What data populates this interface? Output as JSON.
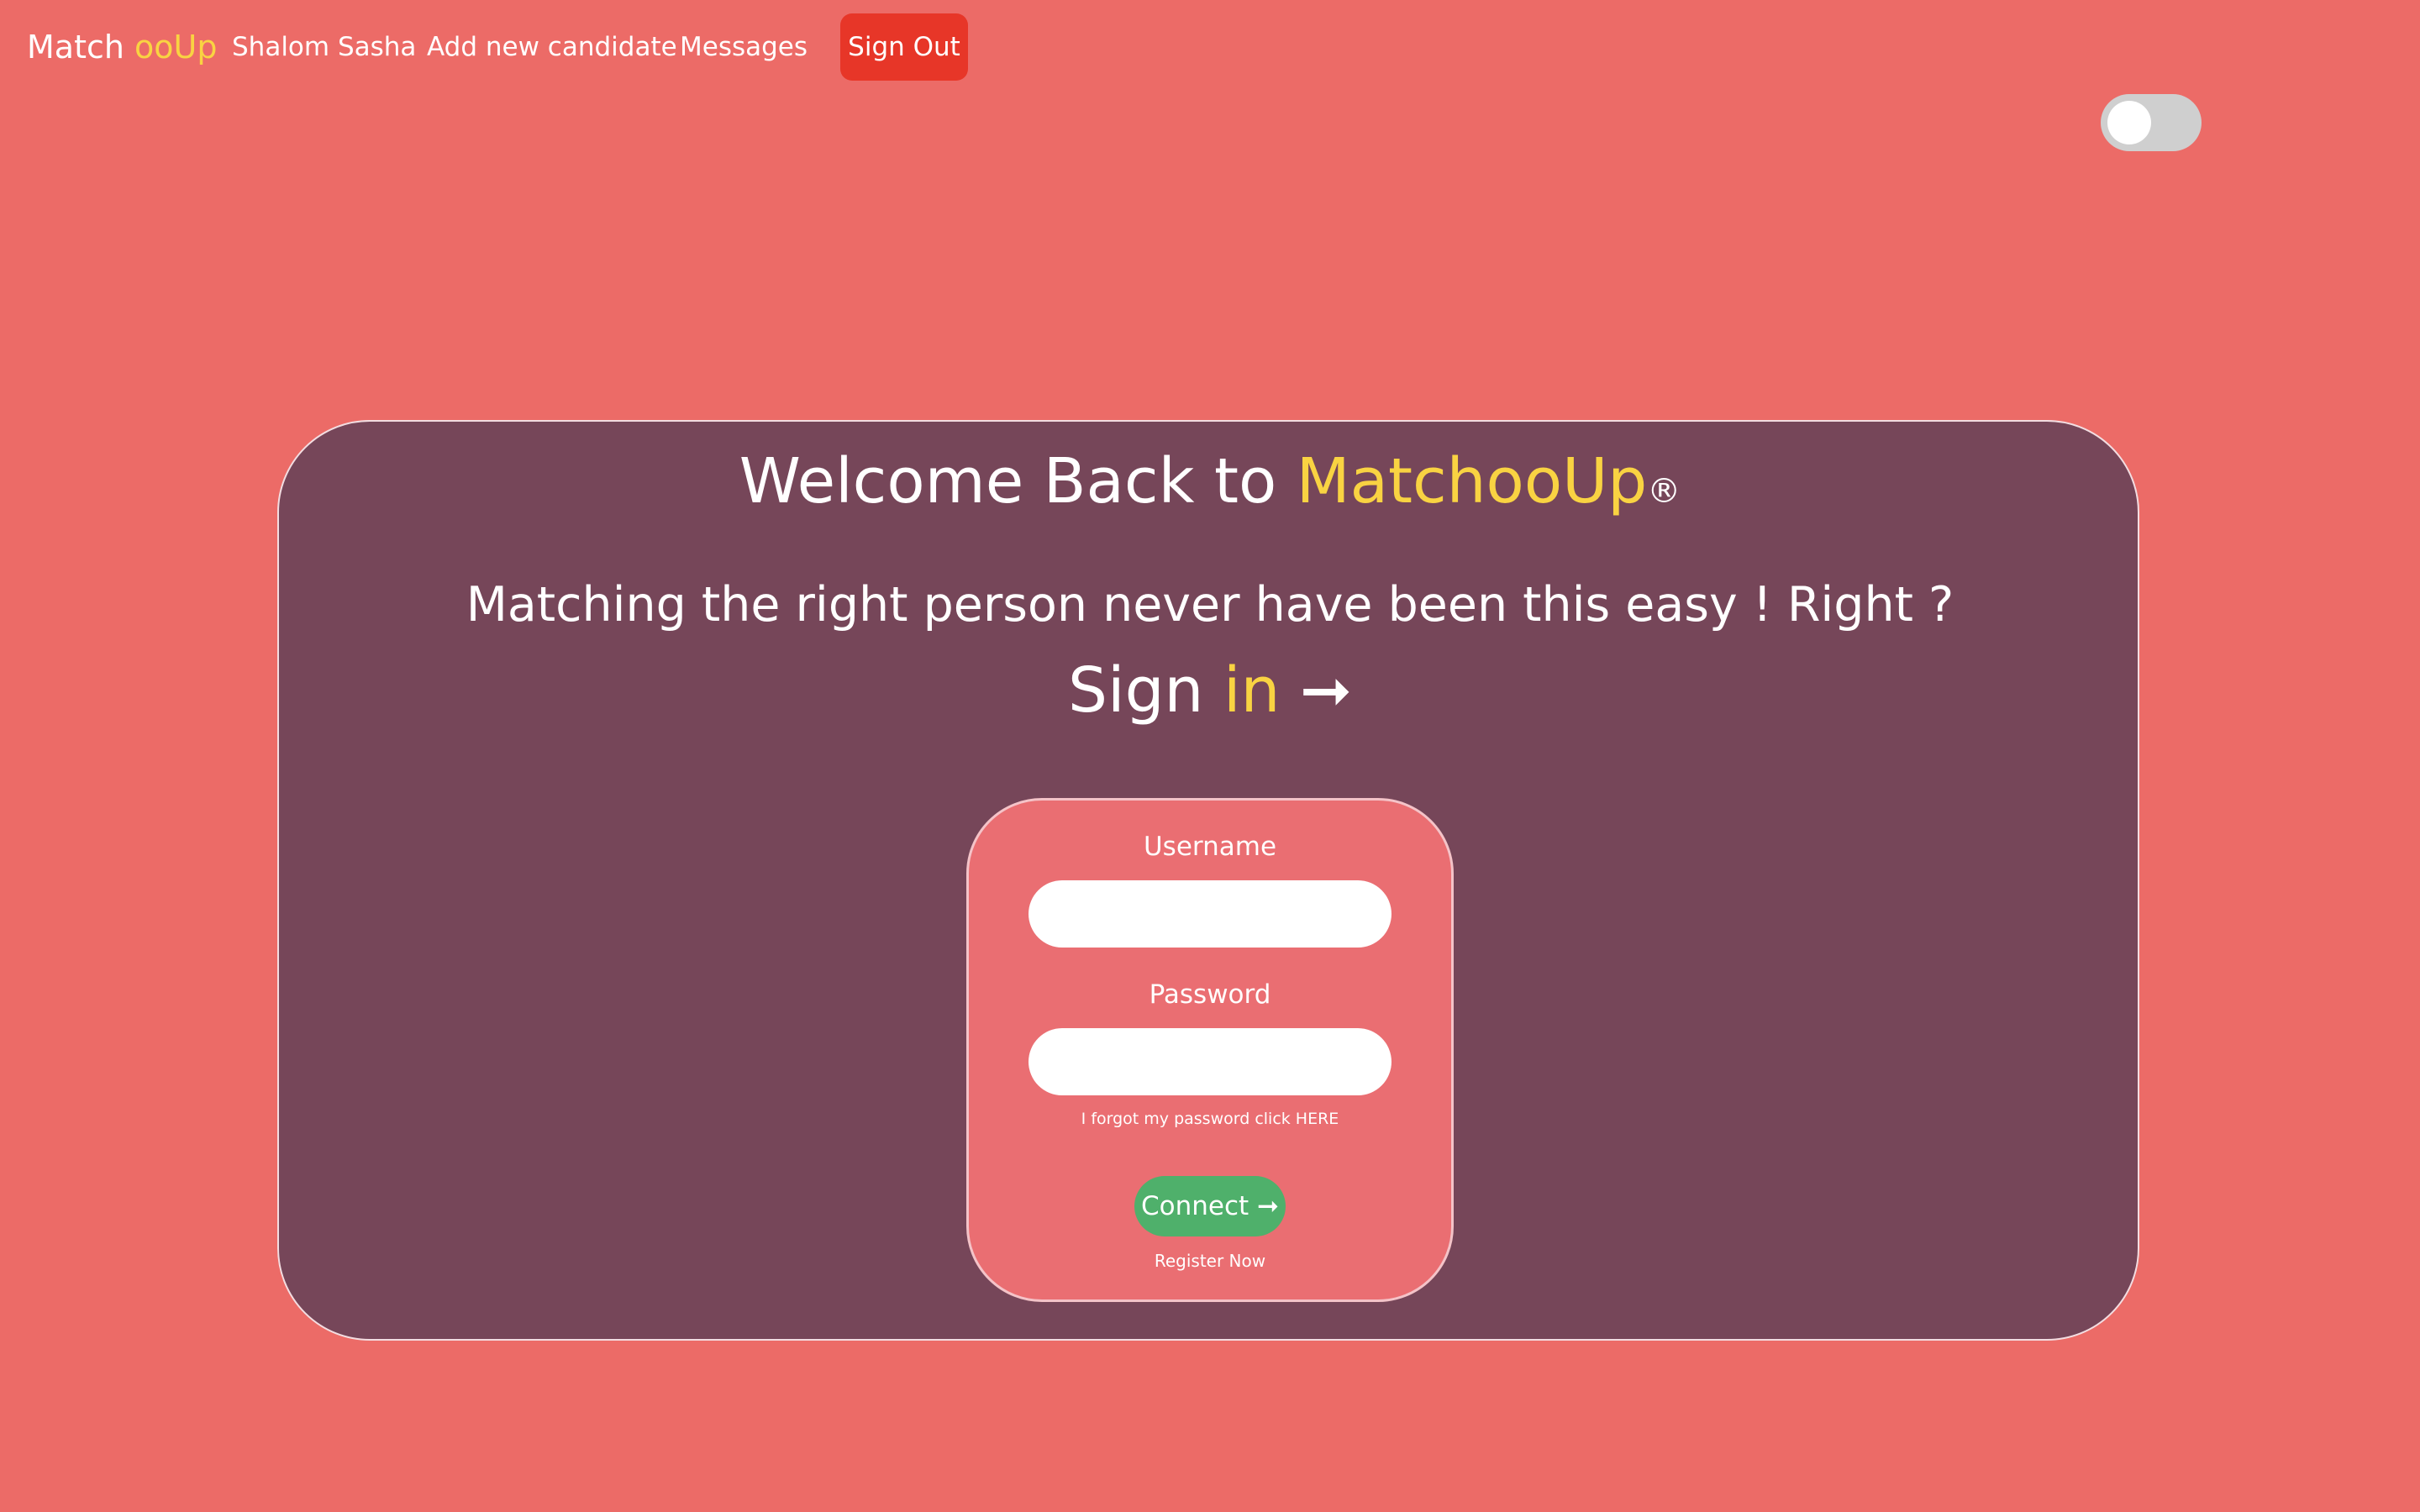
{
  "colors": {
    "background": "#ec6b67",
    "card": "#764659",
    "form_box": "#ea6e72",
    "accent": "#f9d342",
    "sign_out": "#e73628",
    "connect": "#4fb06b",
    "toggle_track": "#cfcfcf"
  },
  "nav": {
    "brand_prefix": "Match ",
    "brand_accent": "ooUp",
    "links": [
      {
        "label": "Shalom Sasha"
      },
      {
        "label": "Add new candidate"
      },
      {
        "label": "Messages"
      }
    ],
    "sign_out_label": "Sign Out"
  },
  "theme_toggle": {
    "state": "off"
  },
  "hero": {
    "welcome_prefix": "Welcome Back to ",
    "welcome_brand": "MatchooUp",
    "registered_mark": "®",
    "tagline": "Matching the right person never have been this easy ! Right ?",
    "sign_in_prefix": "Sign ",
    "sign_in_accent": "in",
    "sign_in_arrow": " ➞"
  },
  "login_form": {
    "username_label": "Username",
    "username_value": "",
    "password_label": "Password",
    "password_value": "",
    "forgot_text": "I forgot my password click HERE",
    "connect_label": "Connect ➞",
    "register_text": "Register Now"
  }
}
